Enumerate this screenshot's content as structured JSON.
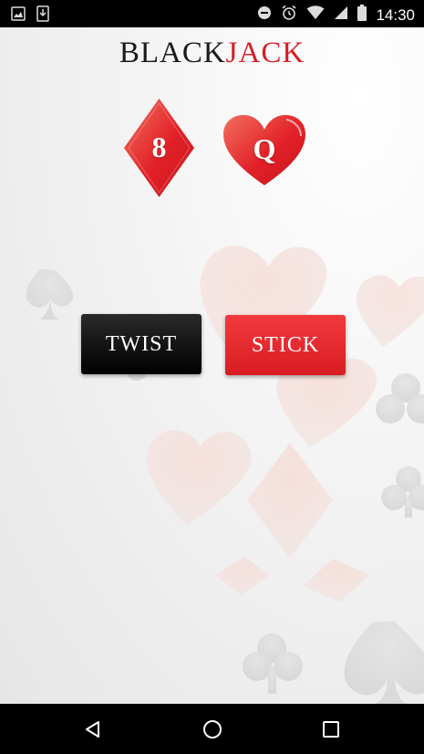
{
  "status_bar": {
    "time": "14:30",
    "left_icons": [
      "image-icon",
      "download-icon"
    ],
    "right_icons": [
      "do-not-disturb-icon",
      "alarm-icon",
      "wifi-icon",
      "signal-icon",
      "battery-icon"
    ]
  },
  "app": {
    "title_part1": "BLACK",
    "title_part2": "JACK"
  },
  "cards": [
    {
      "value": "8",
      "suit": "diamond"
    },
    {
      "value": "Q",
      "suit": "heart"
    }
  ],
  "buttons": {
    "twist_label": "TWIST",
    "stick_label": "STICK"
  },
  "colors": {
    "accent_red": "#d61f26",
    "twist_bg": "#000000",
    "stick_bg": "#e52227"
  },
  "nav_bar": {
    "icons": [
      "back-icon",
      "home-icon",
      "recents-icon"
    ]
  }
}
